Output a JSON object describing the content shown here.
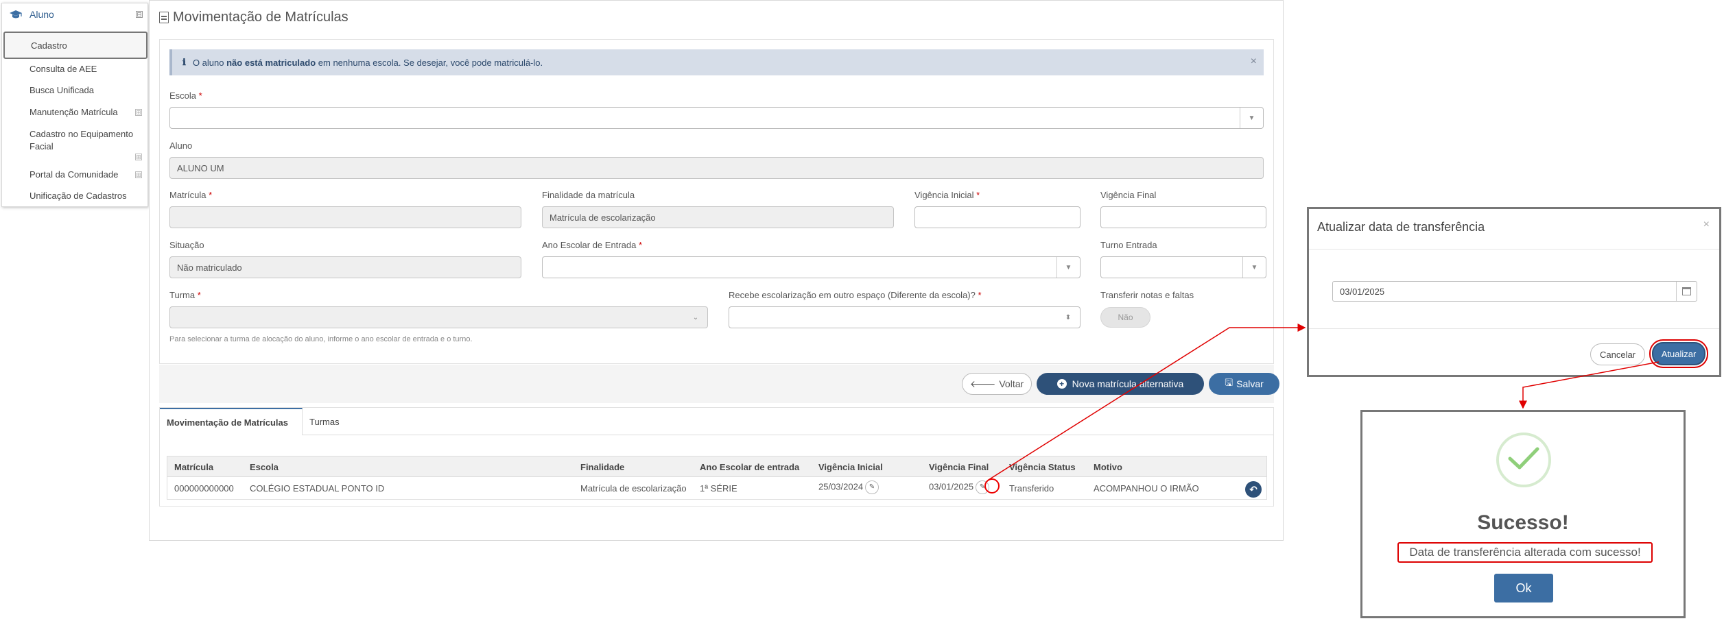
{
  "sidebar": {
    "module": "Aluno",
    "toggle": "⊟",
    "items": [
      {
        "label": "Cadastro"
      },
      {
        "label": "Consulta de AEE"
      },
      {
        "label": "Busca Unificada"
      },
      {
        "label": "Manutenção Matrícula",
        "expand": "⊞"
      },
      {
        "label": "Cadastro no Equipamento Facial",
        "expand": "⊞"
      },
      {
        "label": "Portal da Comunidade",
        "expand": "⊞"
      },
      {
        "label": "Unificação de Cadastros"
      }
    ]
  },
  "page": {
    "title": "Movimentação de Matrículas",
    "alert": {
      "icon": "ℹ",
      "prefix": "O aluno ",
      "bold": "não está matriculado",
      "suffix": " em nenhuma escola. Se desejar, você pode matriculá-lo.",
      "close": "×"
    }
  },
  "form": {
    "escola": {
      "label": "Escola",
      "req": "*",
      "value": ""
    },
    "aluno": {
      "label": "Aluno",
      "value": "ALUNO UM"
    },
    "matricula": {
      "label": "Matrícula",
      "req": "*",
      "value": ""
    },
    "finalidade": {
      "label": "Finalidade da matrícula",
      "value": "Matrícula de escolarização"
    },
    "vig_inicial": {
      "label": "Vigência Inicial",
      "req": "*",
      "value": ""
    },
    "vig_final": {
      "label": "Vigência Final",
      "value": ""
    },
    "situacao": {
      "label": "Situação",
      "value": "Não matriculado"
    },
    "ano_escolar": {
      "label": "Ano Escolar de Entrada",
      "req": "*",
      "value": ""
    },
    "turno": {
      "label": "Turno Entrada",
      "value": ""
    },
    "turma": {
      "label": "Turma",
      "req": "*",
      "value": "",
      "hint": "Para selecionar a turma de alocação do aluno, informe o ano escolar de entrada e o turno."
    },
    "outro_espaco": {
      "label": "Recebe escolarização em outro espaço (Diferente da escola)?",
      "req": "*",
      "value": ""
    },
    "transferir": {
      "label": "Transferir notas e faltas",
      "value": "Não"
    }
  },
  "buttons": {
    "voltar": "Voltar",
    "voltar_icon": "🡐",
    "nova": "Nova matrícula alternativa",
    "salvar": "Salvar",
    "nova_icon": "+",
    "salvar_icon": "🖫"
  },
  "tabs": [
    {
      "label": "Movimentação de Matrículas",
      "active": true
    },
    {
      "label": "Turmas",
      "active": false
    }
  ],
  "table": {
    "columns": [
      "Matrícula",
      "Escola",
      "Finalidade",
      "Ano Escolar de entrada",
      "Vigência Inicial",
      "Vigência Final",
      "Vigência Status",
      "Motivo"
    ],
    "rows": [
      {
        "matricula": "000000000000",
        "escola": "COLÉGIO ESTADUAL PONTO ID",
        "finalidade": "Matrícula de escolarização",
        "ano": "1ª SÉRIE",
        "vig_inicial": "25/03/2024",
        "vig_final": "03/01/2025",
        "status": "Transferido",
        "motivo": "ACOMPANHOU O IRMÃO"
      }
    ],
    "edit_icon": "✎",
    "undo_icon": "↶"
  },
  "modal": {
    "title": "Atualizar data de transferência",
    "close": "×",
    "date_value": "03/01/2025",
    "cancel": "Cancelar",
    "update": "Atualizar"
  },
  "success": {
    "title": "Sucesso!",
    "message": "Data de transferência alterada com sucesso!",
    "ok": "Ok"
  },
  "colors": {
    "primary": "#3c6ea3",
    "dark_primary": "#2e5179",
    "alert_bg": "#d6dde8",
    "annotation_red": "#e00000",
    "success_green": "#8fcf7a"
  }
}
